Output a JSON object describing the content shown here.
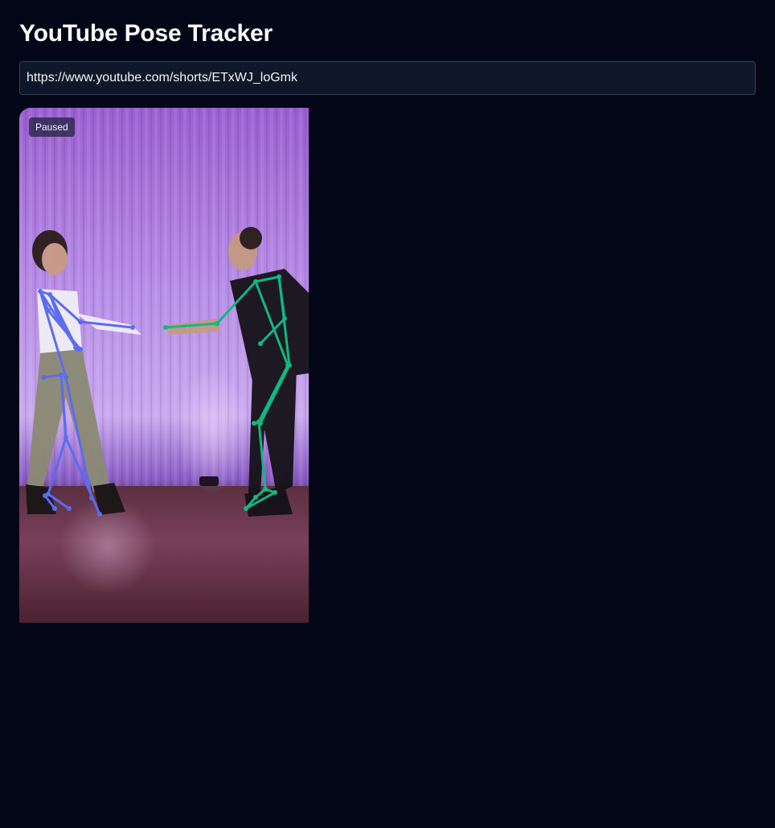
{
  "page": {
    "title": "YouTube Pose Tracker"
  },
  "url_input": {
    "value": "https://www.youtube.com/shorts/ETxWJ_loGmk",
    "placeholder": "https://www.youtube.com/shorts/ETxWJ_loGmk"
  },
  "player": {
    "status": "Paused",
    "skeleton_colors": {
      "left_dancer": "#5b6cf0",
      "right_dancer": "#10b981"
    }
  }
}
